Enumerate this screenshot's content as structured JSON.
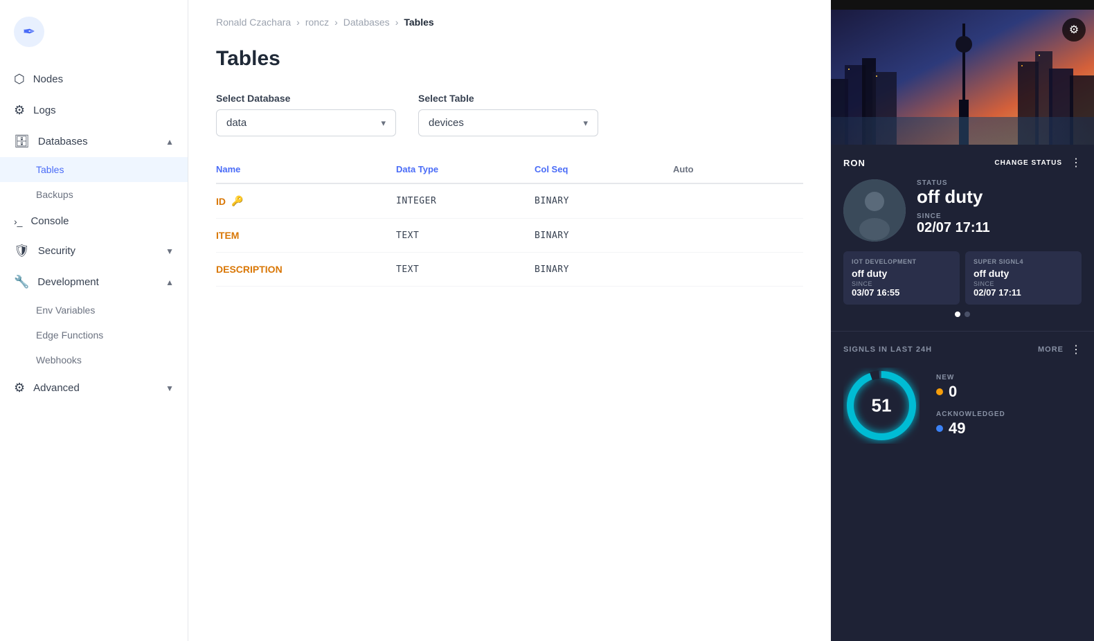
{
  "sidebar": {
    "logo_icon": "✒",
    "items": [
      {
        "id": "nodes",
        "label": "Nodes",
        "icon": "⬡",
        "hasChildren": false
      },
      {
        "id": "logs",
        "label": "Logs",
        "icon": "⚙",
        "hasChildren": false
      },
      {
        "id": "databases",
        "label": "Databases",
        "icon": "🗄",
        "hasChildren": true,
        "expanded": true
      },
      {
        "id": "console",
        "label": "Console",
        "icon": ">_",
        "hasChildren": false
      },
      {
        "id": "security",
        "label": "Security",
        "icon": "🛡",
        "hasChildren": true,
        "expanded": false
      },
      {
        "id": "development",
        "label": "Development",
        "icon": "🔧",
        "hasChildren": true,
        "expanded": true
      },
      {
        "id": "advanced",
        "label": "Advanced",
        "icon": "⚙",
        "hasChildren": true,
        "expanded": false
      }
    ],
    "sub_items": {
      "databases": [
        "Tables",
        "Backups"
      ],
      "development": [
        "Env Variables",
        "Edge Functions",
        "Webhooks"
      ]
    }
  },
  "breadcrumb": {
    "items": [
      "Ronald Czachara",
      "roncz",
      "Databases",
      "Tables"
    ]
  },
  "main": {
    "page_title": "Tables",
    "select_database_label": "Select Database",
    "select_table_label": "Select Table",
    "database_value": "data",
    "table_value": "devices",
    "table_columns": [
      "Name",
      "Data Type",
      "Col Seq",
      "Auto"
    ],
    "table_rows": [
      {
        "name": "ID",
        "is_key": true,
        "data_type": "INTEGER",
        "col_seq": "BINARY",
        "auto": ""
      },
      {
        "name": "ITEM",
        "is_key": false,
        "data_type": "TEXT",
        "col_seq": "BINARY",
        "auto": ""
      },
      {
        "name": "DESCRIPTION",
        "is_key": false,
        "data_type": "TEXT",
        "col_seq": "BINARY",
        "auto": ""
      }
    ]
  },
  "right_panel": {
    "user_name": "RON",
    "change_status_label": "CHANGE STATUS",
    "status": {
      "label": "STATUS",
      "value": "off duty",
      "since_label": "SINCE",
      "since_value": "02/07 17:11"
    },
    "sub_statuses": [
      {
        "group_label": "IOT DEVELOPMENT",
        "value": "off duty",
        "since_label": "SINCE",
        "since_value": "03/07 16:55"
      },
      {
        "group_label": "SUPER SIGNL4",
        "value": "off duty",
        "since_label": "SINCE",
        "since_value": "02/07 17:11"
      }
    ],
    "signals": {
      "title": "SIGNLS IN LAST 24H",
      "more_label": "MORE",
      "count": "51",
      "new_label": "NEW",
      "new_count": "0",
      "acknowledged_label": "ACKNOWLEDGED",
      "acknowledged_count": "49"
    }
  }
}
